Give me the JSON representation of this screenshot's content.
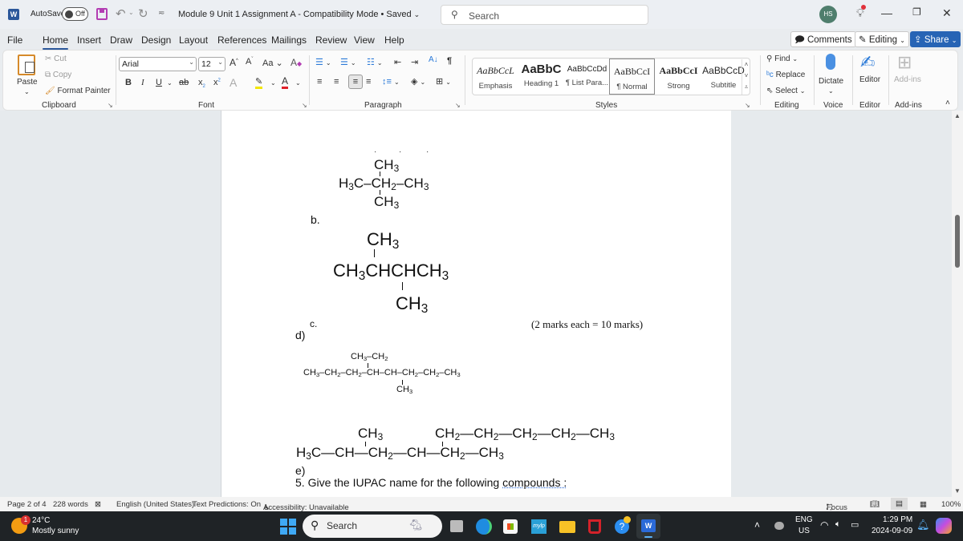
{
  "titlebar": {
    "app_icon": "word-icon",
    "autosave_label": "AutoSave",
    "autosave_state": "Off",
    "doc_title": "Module 9 Unit 1 Assignment A  -  Compatibility Mode • Saved",
    "search_placeholder": "Search",
    "avatar_initials": "HS"
  },
  "tabs": [
    "File",
    "Home",
    "Insert",
    "Draw",
    "Design",
    "Layout",
    "References",
    "Mailings",
    "Review",
    "View",
    "Help"
  ],
  "active_tab": "Home",
  "actions": {
    "comments": "Comments",
    "editing": "Editing",
    "share": "Share"
  },
  "ribbon": {
    "clipboard": {
      "paste": "Paste",
      "cut": "Cut",
      "copy": "Copy",
      "format_painter": "Format Painter",
      "label": "Clipboard"
    },
    "font": {
      "name": "Arial",
      "size": "12",
      "label": "Font",
      "case": "Aa"
    },
    "paragraph": {
      "label": "Paragraph"
    },
    "styles": {
      "label": "Styles",
      "items": [
        {
          "preview": "AaBbCcL",
          "name": "Emphasis"
        },
        {
          "preview": "AaBbC",
          "name": "Heading 1"
        },
        {
          "preview": "AaBbCcDd",
          "name": "¶ List Para..."
        },
        {
          "preview": "AaBbCcI",
          "name": "¶ Normal",
          "selected": true
        },
        {
          "preview": "AaBbCcI",
          "name": "Strong"
        },
        {
          "preview": "AaBbCcD",
          "name": "Subtitle"
        }
      ]
    },
    "editing": {
      "find": "Find",
      "replace": "Replace",
      "select": "Select",
      "label": "Editing"
    },
    "voice": {
      "dictate": "Dictate",
      "label": "Voice"
    },
    "editor": {
      "editor": "Editor",
      "label": "Editor"
    },
    "addins": {
      "addins": "Add-ins",
      "label": "Add-ins"
    }
  },
  "document": {
    "a_top": {
      "ch3_top": "CH",
      "row_left": "H",
      "row_mid": "C–CH",
      "row_right": "–CH",
      "ch3_bottom": "CH"
    },
    "label_b": "b.",
    "b": {
      "top": "CH",
      "main_parts": [
        "CH",
        "CHCHCH"
      ],
      "bottom": "CH"
    },
    "label_c": "c.",
    "marks": "(2 marks each = 10 marks)",
    "label_d": "d)",
    "d": {
      "branch_top": "CH3–CH2",
      "main": "CH3–CH2–CH2–CH–CH–CH2–CH2–CH3",
      "branch_bottom": "CH3"
    },
    "e": {
      "top_left": "CH3",
      "top_right": "CH2—CH2—CH2—CH2—CH3",
      "main": "H3C—CH—CH2—CH—CH2—CH3"
    },
    "label_e": "e)",
    "question_5_prefix": "5.  Give the IUPAC name for the following ",
    "question_5_link": "compounds :"
  },
  "statusbar": {
    "page": "Page 2 of 4",
    "words": "228 words",
    "language": "English (United States)",
    "predictions": "Text Predictions: On",
    "accessibility": "Accessibility: Unavailable",
    "focus": "Focus",
    "zoom": "100%"
  },
  "taskbar": {
    "weather_temp": "24°C",
    "weather_desc": "Mostly sunny",
    "weather_badge": "1",
    "search_placeholder": "Search",
    "lang_top": "ENG",
    "lang_bottom": "US",
    "time": "1:29 PM",
    "date": "2024-09-09"
  }
}
